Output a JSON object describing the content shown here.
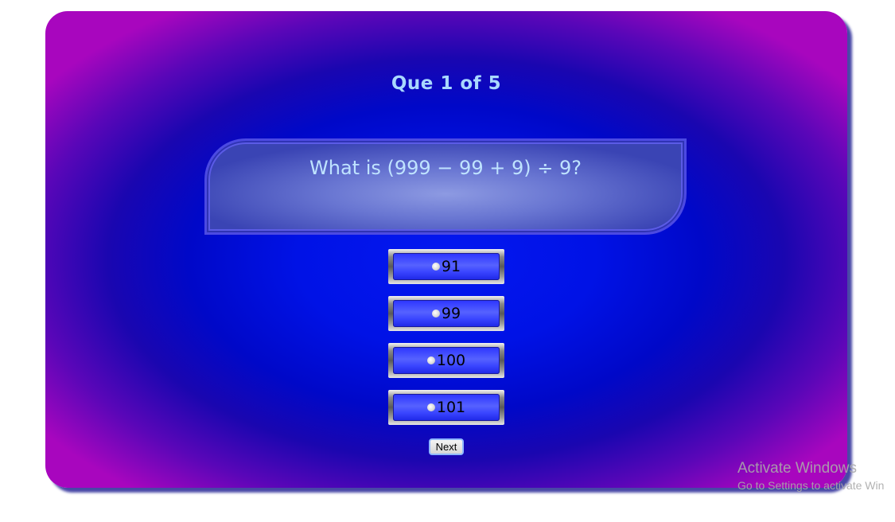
{
  "quiz": {
    "progress": "Que 1 of 5",
    "question": "What is (999 − 99 + 9) ÷ 9?",
    "options": [
      {
        "label": "91"
      },
      {
        "label": "99"
      },
      {
        "label": "100"
      },
      {
        "label": "101"
      }
    ],
    "next_label": "Next"
  },
  "watermark": {
    "title": "Activate Windows",
    "subtitle": "Go to Settings to activate Win"
  },
  "colors": {
    "card_center": "#0418f0",
    "card_edge": "#a806be",
    "title_text": "#a9d8ff",
    "question_text": "#bfe3ff",
    "option_fill": "#3a45ff"
  }
}
